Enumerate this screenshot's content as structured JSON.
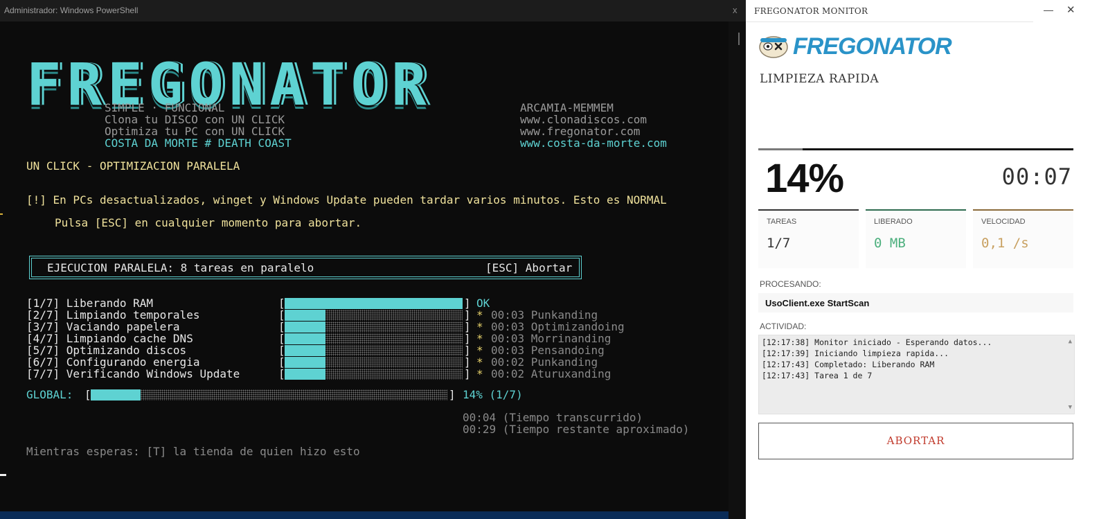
{
  "powershell": {
    "window_title": "Administrador: Windows PowerShell",
    "close_glyph": "x",
    "logo_text": "FREGONATOR",
    "left_info": [
      "SIMPLE · FUNCIONAL",
      "Clona tu DISCO con UN CLICK",
      "Optimiza tu PC con UN CLICK",
      "COSTA DA MORTE # DEATH COAST"
    ],
    "right_info": [
      "ARCAMIA-MEMMEM",
      "www.clonadiscos.com",
      "www.fregonator.com",
      "www.costa-da-morte.com"
    ],
    "mode_heading": "UN CLICK - OPTIMIZACION PARALELA",
    "warning_line": "[!] En PCs desactualizados, winget y Windows Update pueden tardar varios minutos. Esto es NORMAL",
    "esc_hint": "Pulsa [ESC] en cualquier momento para abortar.",
    "exec_box_left": "EJECUCION PARALELA: 8 tareas en paralelo",
    "exec_box_right": "[ESC] Abortar",
    "tasks": [
      {
        "label": "[1/7] Liberando RAM",
        "progress": 1.0,
        "status_mark": "",
        "status": "OK"
      },
      {
        "label": "[2/7] Limpiando temporales",
        "progress": 0.23,
        "status_mark": "*",
        "status": "00:03 Punkanding"
      },
      {
        "label": "[3/7] Vaciando papelera",
        "progress": 0.23,
        "status_mark": "*",
        "status": "00:03 Optimizandoing"
      },
      {
        "label": "[4/7] Limpiando cache DNS",
        "progress": 0.23,
        "status_mark": "*",
        "status": "00:03 Morrinanding"
      },
      {
        "label": "[5/7] Optimizando discos",
        "progress": 0.23,
        "status_mark": "*",
        "status": "00:03 Pensandoing"
      },
      {
        "label": "[6/7] Configurando energia",
        "progress": 0.23,
        "status_mark": "*",
        "status": "00:02 Punkanding"
      },
      {
        "label": "[7/7] Verificando Windows Update",
        "progress": 0.23,
        "status_mark": "*",
        "status": "00:02 Aturuxanding"
      }
    ],
    "global_label": "GLOBAL:",
    "global_progress": 0.14,
    "global_text": "14% (1/7)",
    "elapsed_line": "00:04 (Tiempo transcurrido)",
    "remaining_line": "00:29 (Tiempo restante aproximado)",
    "wait_hint": "Mientras esperas: [T] la tienda de quien hizo esto",
    "bracket_open": "[",
    "bracket_close": "]"
  },
  "monitor": {
    "window_title": "FREGONATOR MONITOR",
    "minimize_glyph": "—",
    "close_glyph": "✕",
    "brand_text": "FREGONATOR",
    "mode": "LIMPIEZA RAPIDA",
    "progress": 0.14,
    "percent_text": "14%",
    "elapsed": "00:07",
    "cards": [
      {
        "label": "TAREAS",
        "value": "1/7",
        "accent": "#333333",
        "value_color": "#333333"
      },
      {
        "label": "LIBERADO",
        "value": "0 MB",
        "accent": "#2e6b4f",
        "value_color": "#4caf7d"
      },
      {
        "label": "VELOCIDAD",
        "value": "0,1 /s",
        "accent": "#8a6a3a",
        "value_color": "#c8a060"
      }
    ],
    "processing_label": "PROCESANDO:",
    "processing_value": "UsoClient.exe StartScan",
    "activity_label": "ACTIVIDAD:",
    "log": [
      "[12:17:38] Monitor iniciado - Esperando datos...",
      "[12:17:39] Iniciando limpieza rapida...",
      "[12:17:43] Completado: Liberando RAM",
      "[12:17:43] Tarea 1 de 7"
    ],
    "abort_label": "ABORTAR",
    "colors": {
      "accent_cyan": "#5ed2d2",
      "brand_blue": "#2a93c8",
      "abort_red": "#c0392b"
    }
  }
}
